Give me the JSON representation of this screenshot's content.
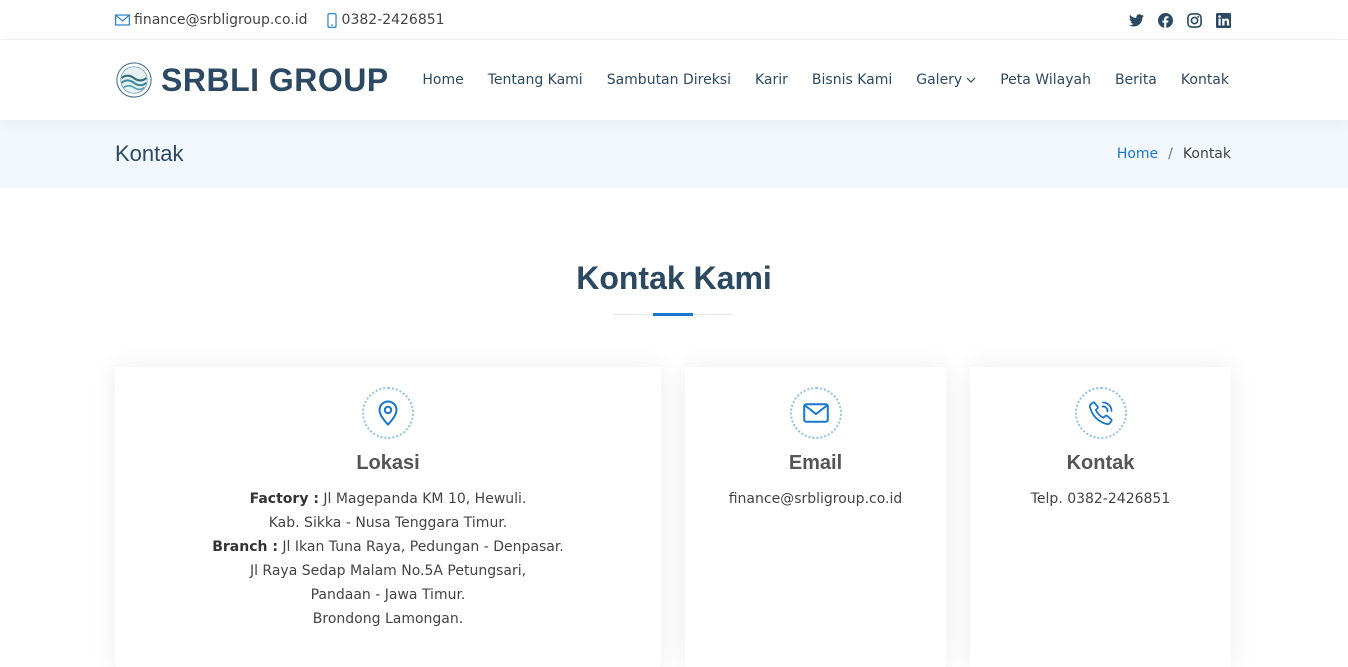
{
  "topbar": {
    "email": "finance@srbligroup.co.id",
    "phone": "0382-2426851"
  },
  "header": {
    "logo_text": "SRBLI GROUP",
    "nav": [
      {
        "label": "Home"
      },
      {
        "label": "Tentang Kami"
      },
      {
        "label": "Sambutan Direksi"
      },
      {
        "label": "Karir"
      },
      {
        "label": "Bisnis Kami"
      },
      {
        "label": "Galery"
      },
      {
        "label": "Peta Wilayah"
      },
      {
        "label": "Berita"
      },
      {
        "label": "Kontak"
      }
    ]
  },
  "breadcrumbs": {
    "page_title": "Kontak",
    "home": "Home",
    "separator": "/",
    "current": "Kontak"
  },
  "section": {
    "title": "Kontak Kami"
  },
  "cards": {
    "lokasi": {
      "title": "Lokasi",
      "factory_label": "Factory :",
      "factory_line1": " Jl Magepanda KM 10, Hewuli.",
      "factory_line2": "Kab. Sikka - Nusa Tenggara Timur.",
      "branch_label": "Branch :",
      "branch_line1": " Jl Ikan Tuna Raya, Pedungan - Denpasar.",
      "branch_line2": "Jl Raya Sedap Malam No.5A Petungsari,",
      "branch_line3": "Pandaan - Jawa Timur.",
      "branch_line4": "Brondong Lamongan."
    },
    "email": {
      "title": "Email",
      "value": "finance@srbligroup.co.id"
    },
    "kontak": {
      "title": "Kontak",
      "value": "Telp. 0382-2426851"
    }
  },
  "colors": {
    "primary": "#1977cc",
    "heading": "#2c4964",
    "breadcrumb_bg": "#f1f7fd"
  },
  "icons": {
    "email": "envelope-icon",
    "phone": "phone-icon",
    "social": [
      "twitter-icon",
      "facebook-icon",
      "instagram-icon",
      "linkedin-icon"
    ],
    "lokasi": "map-pin-icon",
    "email_card": "envelope-icon",
    "kontak_card": "phone-call-icon"
  }
}
